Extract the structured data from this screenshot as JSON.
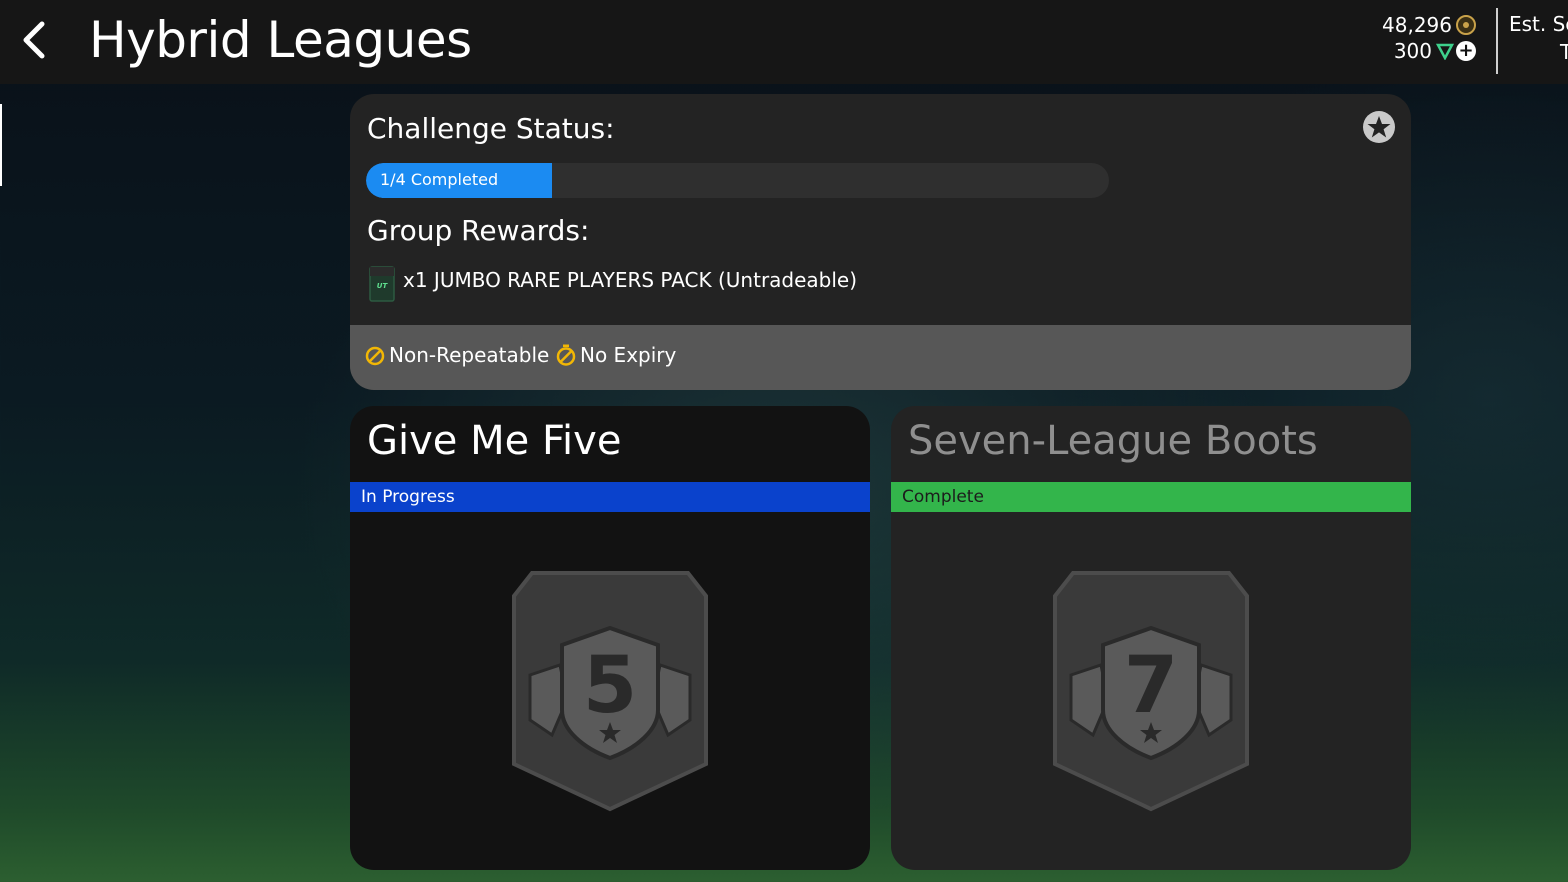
{
  "header": {
    "title": "Hybrid Leagues",
    "coins": "48,296",
    "points": "300",
    "est_label": "Est. Se",
    "est_sub": "T"
  },
  "challenge_status": {
    "heading": "Challenge Status:",
    "progress_label": "1/4 Completed",
    "progress_fraction": 0.25,
    "rewards_heading": "Group Rewards:",
    "reward_item": "x1 JUMBO RARE PLAYERS PACK (Untradeable)",
    "pack_badge_text": "UT",
    "tags": [
      "Non-Repeatable",
      "No Expiry"
    ]
  },
  "challenges": [
    {
      "title": "Give Me Five",
      "status": "In Progress",
      "badge_number": "5"
    },
    {
      "title": "Seven-League Boots",
      "status": "Complete",
      "badge_number": "7"
    }
  ],
  "colors": {
    "progress": "#1b8bf2",
    "in_progress": "#0a42cc",
    "complete": "#33b54b",
    "tag_icon": "#f2b705"
  },
  "icons": [
    "back-arrow-icon",
    "coin-icon",
    "points-icon",
    "plus-icon",
    "star-icon",
    "pack-icon",
    "repeat-icon",
    "timer-icon",
    "shield-badge-icon"
  ]
}
